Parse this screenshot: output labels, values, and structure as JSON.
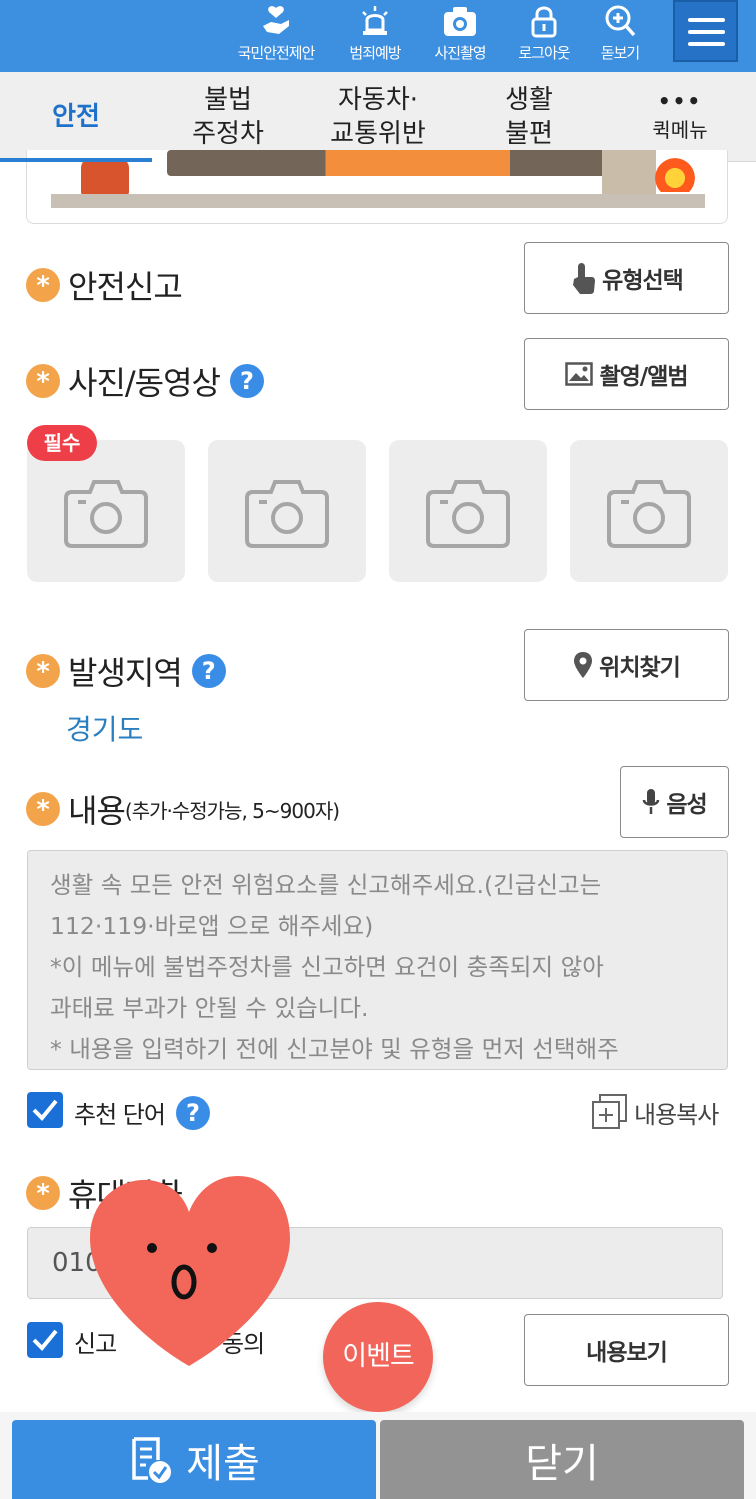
{
  "header": {
    "items": [
      {
        "label": "국민안전제안",
        "icon": "hand-heart-icon"
      },
      {
        "label": "범죄예방",
        "icon": "siren-icon"
      },
      {
        "label": "사진촬영",
        "icon": "camera-icon"
      },
      {
        "label": "로그아웃",
        "icon": "lock-icon"
      },
      {
        "label": "돋보기",
        "icon": "magnifier-plus-icon"
      }
    ],
    "menu_icon": "hamburger-menu-icon"
  },
  "tabs": [
    {
      "label": "안전",
      "active": true
    },
    {
      "label": "불법\n주정차",
      "active": false
    },
    {
      "label": "자동차·\n교통위반",
      "active": false
    },
    {
      "label": "생활\n불편",
      "active": false
    }
  ],
  "quick_menu": {
    "dots": "•••",
    "label": "퀵메뉴"
  },
  "form": {
    "safety_report": {
      "label": "안전신고",
      "button": "유형선택"
    },
    "media": {
      "label": "사진/동영상",
      "help": "?",
      "button": "촬영/앨범",
      "required_badge": "필수",
      "slots": 4
    },
    "location": {
      "label": "발생지역",
      "help": "?",
      "button": "위치찾기",
      "value": "경기도"
    },
    "content": {
      "label": "내용",
      "sub": "(추가·수정가능, 5~900자)",
      "voice_button": "음성",
      "placeholder_lines": [
        "생활 속 모든 안전 위험요소를 신고해주세요.(긴급신고는",
        "112·119·바로앱 으로 해주세요)",
        "*이 메뉴에 불법주정차를 신고하면 요건이 충족되지 않아",
        "과태료 부과가 안될 수 있습니다.",
        "* 내용을 입력하기 전에 신고분야 및 유형을 먼저 선택해주"
      ]
    },
    "recommend": {
      "label": "추천 단어",
      "help": "?",
      "checked": true
    },
    "copy_button": "내용복사",
    "phone": {
      "label": "휴대전화",
      "value": "010"
    },
    "consent": {
      "label": "신고",
      "suffix": "동의",
      "checked": true
    },
    "view_button": "내용보기"
  },
  "event_button": "이벤트",
  "footer": {
    "submit": "제출",
    "close": "닫기"
  },
  "colors": {
    "primary": "#3d8fe0",
    "accent_orange": "#f3a44a",
    "badge_red": "#ee3f48",
    "event": "#f1655a"
  }
}
